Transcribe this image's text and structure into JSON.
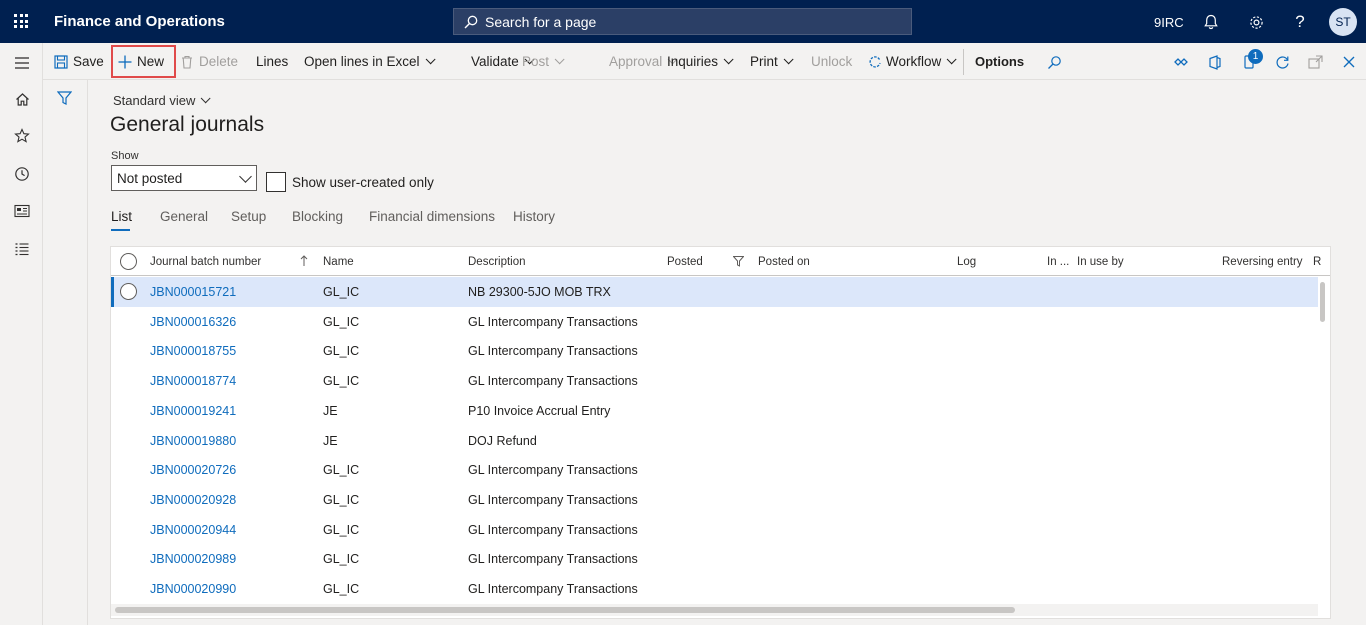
{
  "app": {
    "title": "Finance and Operations",
    "company": "9IRC",
    "avatar_initials": "ST"
  },
  "search": {
    "placeholder": "Search for a page"
  },
  "toolbar": {
    "save": "Save",
    "new": "New",
    "delete": "Delete",
    "lines": "Lines",
    "open_excel": "Open lines in Excel",
    "validate": "Validate",
    "post": "Post",
    "approval": "Approval",
    "inquiries": "Inquiries",
    "print": "Print",
    "unlock": "Unlock",
    "workflow": "Workflow",
    "options": "Options",
    "notification_count": "1"
  },
  "page": {
    "view": "Standard view",
    "title": "General journals",
    "show_label": "Show",
    "show_value": "Not posted",
    "user_created_label": "Show user-created only"
  },
  "tabs": [
    "List",
    "General",
    "Setup",
    "Blocking",
    "Financial dimensions",
    "History"
  ],
  "grid": {
    "columns": [
      "Journal batch number",
      "Name",
      "Description",
      "Posted",
      "Posted on",
      "Log",
      "In ...",
      "In use by",
      "Reversing entry",
      "R"
    ],
    "rows": [
      {
        "batch": "JBN000015721",
        "name": "GL_IC",
        "desc": "NB 29300-5JO MOB TRX"
      },
      {
        "batch": "JBN000016326",
        "name": "GL_IC",
        "desc": "GL Intercompany Transactions"
      },
      {
        "batch": "JBN000018755",
        "name": "GL_IC",
        "desc": "GL Intercompany Transactions"
      },
      {
        "batch": "JBN000018774",
        "name": "GL_IC",
        "desc": "GL Intercompany Transactions"
      },
      {
        "batch": "JBN000019241",
        "name": "JE",
        "desc": "P10 Invoice Accrual Entry"
      },
      {
        "batch": "JBN000019880",
        "name": "JE",
        "desc": "DOJ Refund"
      },
      {
        "batch": "JBN000020726",
        "name": "GL_IC",
        "desc": "GL Intercompany Transactions"
      },
      {
        "batch": "JBN000020928",
        "name": "GL_IC",
        "desc": "GL Intercompany Transactions"
      },
      {
        "batch": "JBN000020944",
        "name": "GL_IC",
        "desc": "GL Intercompany Transactions"
      },
      {
        "batch": "JBN000020989",
        "name": "GL_IC",
        "desc": "GL Intercompany Transactions"
      },
      {
        "batch": "JBN000020990",
        "name": "GL_IC",
        "desc": "GL Intercompany Transactions"
      }
    ]
  },
  "colors": {
    "nav_bg": "#002050",
    "accent": "#0f6cbd",
    "highlight": "#e04a4a",
    "selected_row": "#dce7fa"
  }
}
